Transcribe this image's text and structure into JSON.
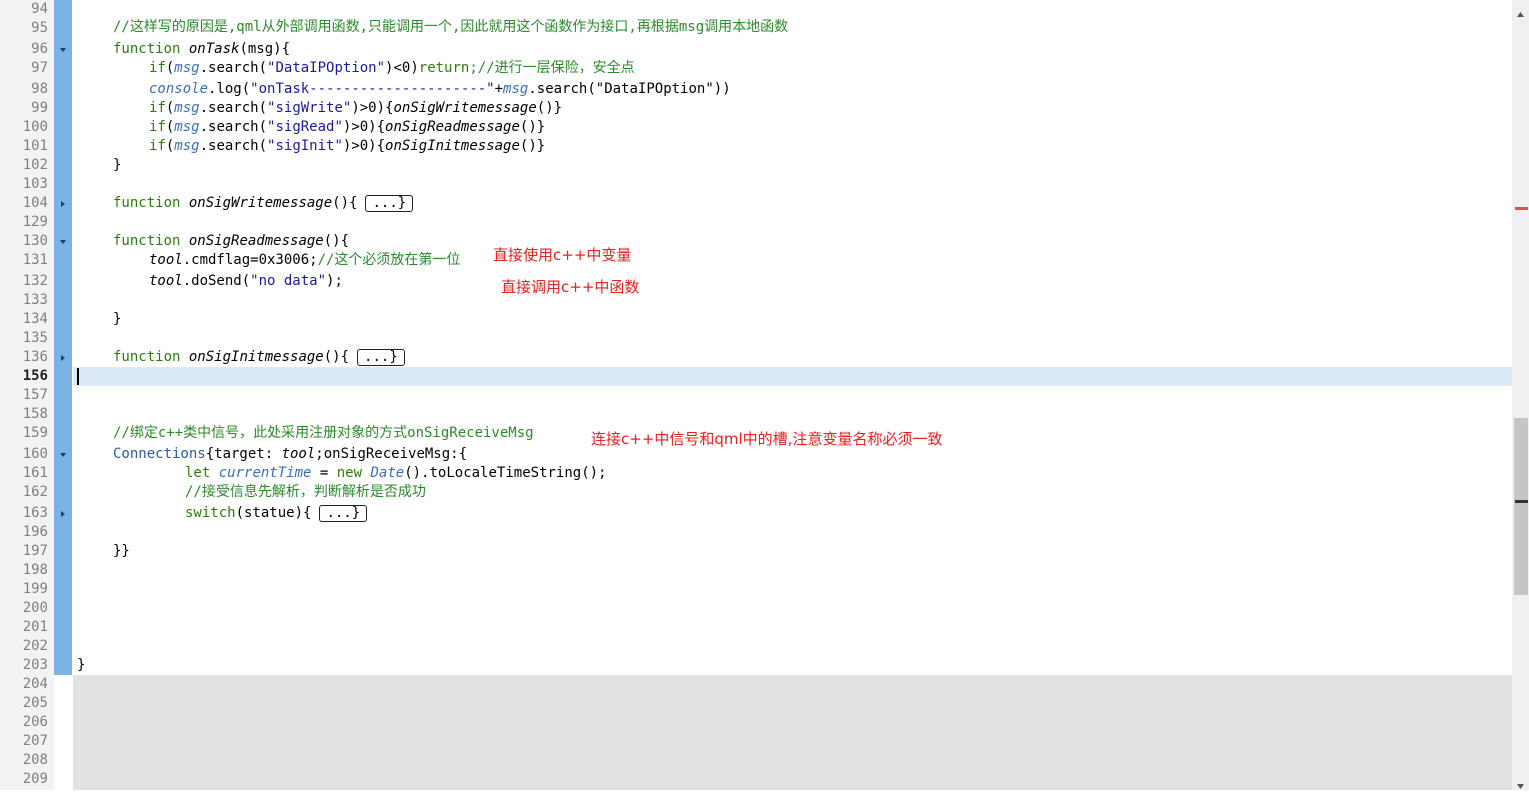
{
  "editor": {
    "gutter_lines": [
      "94",
      "95",
      "96",
      "97",
      "98",
      "99",
      "100",
      "101",
      "102",
      "103",
      "104",
      "129",
      "130",
      "131",
      "132",
      "133",
      "134",
      "135",
      "136",
      "156",
      "157",
      "158",
      "159",
      "160",
      "161",
      "162",
      "163",
      "196",
      "197",
      "198",
      "199",
      "200",
      "201",
      "202",
      "203",
      "204",
      "205",
      "206",
      "207",
      "208",
      "209"
    ],
    "current_line": "156",
    "fold_markers": [
      {
        "line": "96",
        "state": "expanded"
      },
      {
        "line": "104",
        "state": "collapsed"
      },
      {
        "line": "130",
        "state": "expanded"
      },
      {
        "line": "136",
        "state": "collapsed"
      },
      {
        "line": "160",
        "state": "expanded"
      },
      {
        "line": "163",
        "state": "collapsed"
      }
    ]
  },
  "code": {
    "l95_comment": "//这样写的原因是,qml从外部调用函数,只能调用一个,因此就用这个函数作为接口,再根据msg调用本地函数",
    "kw_function": "function",
    "l96_name": "onTask",
    "l96_rest": "(msg){",
    "kw_if": "if",
    "msg": "msg",
    "dot_search": ".search(",
    "l97_str": "\"DataIPOption\"",
    "l97_mid": ")<0)",
    "kw_return": "return",
    "l97_comment": ";//进行一层保险，安全点",
    "console": "console",
    "l98_log": ".log(",
    "l98_str": "\"onTask---------------------\"",
    "l98_plus": "+",
    "l98_rest": ".search(\"DataIPOption\"))",
    "l99_open": "(",
    "l99_str": "\"sigWrite\"",
    "l99_gt": ")>0){",
    "l99_call": "onSigWritemessage",
    "l99_close": "()}",
    "l100_str": "\"sigRead\"",
    "l100_call": "onSigReadmessage",
    "l101_str": "\"sigInit\"",
    "l101_call": "onSigInitmessage",
    "brace_close": "}",
    "l104_name": "onSigWritemessage",
    "paren_open_brace": "(){",
    "folded_label": "...}",
    "l130_name": "onSigReadmessage",
    "tool": "tool",
    "l131_code": ".cmdflag=0x3006;",
    "l131_comment": "//这个必须放在第一位",
    "l132_code": ".doSend(",
    "l132_str": "\"no data\"",
    "l132_end": ");",
    "l136_name": "onSigInitmessage",
    "l159_comment": "//绑定c++类中信号，此处采用注册对象的方式onSigReceiveMsg",
    "l160_type": "Connections",
    "l160_mid": "{target: ",
    "l160_rest": ";onSigReceiveMsg:{",
    "kw_let": "let",
    "l161_var": "currentTime",
    "l161_eq": " = ",
    "kw_new": "new",
    "l161_date": "Date",
    "l161_rest": "().toLocaleTimeString();",
    "l162_comment": "//接受信息先解析，判断解析是否成功",
    "kw_switch": "switch",
    "l163_rest": "(statue){",
    "l197": "}}",
    "l203": "}"
  },
  "annotations": {
    "note1": "直接使用c++中变量",
    "note2": "直接调用c++中函数",
    "note3": "连接c++中信号和qml中的槽,注意变量名称必须一致"
  }
}
